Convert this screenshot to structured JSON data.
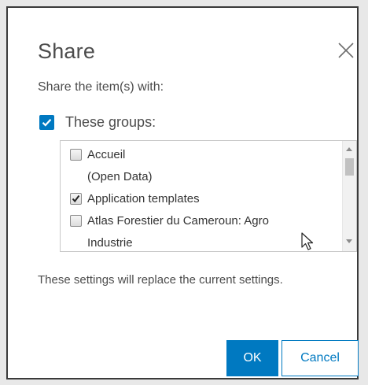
{
  "dialog": {
    "title": "Share",
    "close_icon": "close-icon",
    "subtitle": "Share the item(s) with:",
    "groups_checkbox": {
      "label": "These groups:",
      "checked": true
    },
    "groups": [
      {
        "label": "Accueil",
        "label_cont": "(Open Data)",
        "checked": false
      },
      {
        "label": "Application templates",
        "label_cont": "",
        "checked": true
      },
      {
        "label": "Atlas Forestier du Cameroun: Agro",
        "label_cont": "Industrie",
        "checked": false
      }
    ],
    "note": "These settings will replace the current settings.",
    "ok_label": "OK",
    "cancel_label": "Cancel"
  },
  "colors": {
    "accent": "#0079c1",
    "text": "#4c4c4c",
    "border": "#3a3a3a"
  }
}
